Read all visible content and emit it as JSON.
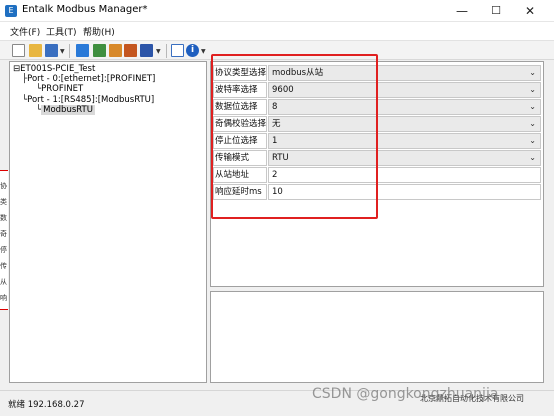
{
  "window": {
    "title": "Entalk Modbus Manager*",
    "minimize": "—",
    "maximize": "☐",
    "close": "✕",
    "app_icon": "E"
  },
  "menu": [
    {
      "label": "文件(F)"
    },
    {
      "label": "工具(T)"
    },
    {
      "label": "帮助(H)"
    }
  ],
  "tree": {
    "root_prefix": "⊟",
    "root": "ET001S-PCIE_Test",
    "port0": "Port - 0:[ethernet]:[PROFINET]",
    "port0_child": "PROFINET",
    "port1": "Port - 1:[RS485]:[ModbusRTU]",
    "port1_child": "ModbusRTU"
  },
  "left_strip_chars": [
    "协",
    "类",
    "数",
    "奇",
    "停",
    "传",
    "从",
    "响"
  ],
  "properties": [
    {
      "label": "协议类型选择",
      "value": "modbus从站",
      "type": "select"
    },
    {
      "label": "波特率选择",
      "value": "9600",
      "type": "select"
    },
    {
      "label": "数据位选择",
      "value": "8",
      "type": "select"
    },
    {
      "label": "奇偶校验选择",
      "value": "无",
      "type": "select"
    },
    {
      "label": "停止位选择",
      "value": "1",
      "type": "select"
    },
    {
      "label": "传输模式",
      "value": "RTU",
      "type": "select"
    },
    {
      "label": "从站地址",
      "value": "2",
      "type": "input"
    },
    {
      "label": "响应延时ms",
      "value": "10",
      "type": "input"
    }
  ],
  "chevron": "⌄",
  "status": {
    "text": "就绪 192.168.0.27",
    "company": "北京鼎拓自动化技术有限公司"
  },
  "watermark": "CSDN @gongkongzhuanjia",
  "colors": {
    "highlight": "#e02020",
    "select_bg": "#eaeaea"
  }
}
